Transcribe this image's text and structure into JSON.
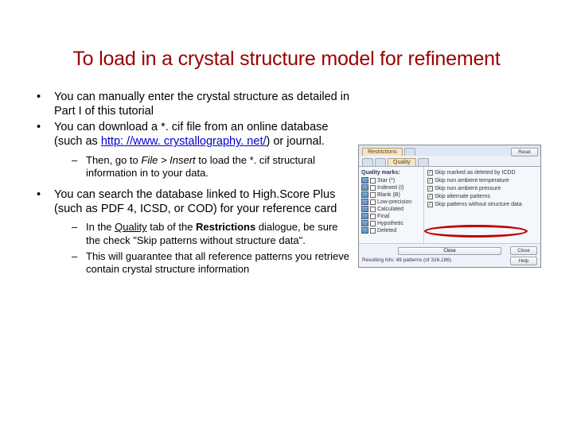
{
  "title": "To load in a crystal structure model for refinement",
  "bullets": {
    "b1": "You can manually enter the crystal structure as detailed in Part I of this tutorial",
    "b2a": "You can download a *. cif file from an online database (such as ",
    "b2_link": "http: //www. crystallography. net/",
    "b2b": ") or journal.",
    "b2_sub1a": "Then, go to ",
    "b2_sub1b": "File > Insert",
    "b2_sub1c": " to load the *. cif structural information in to your data.",
    "b3": "You can search the database linked to High.Score Plus (such as PDF 4, ICSD, or COD) for your reference card",
    "b3_sub1a": "In the ",
    "b3_sub1b": "Quality",
    "b3_sub1c": " tab of the ",
    "b3_sub1d": "Restrictions",
    "b3_sub1e": " dialogue, be sure the check \"Skip patterns without structure data\".",
    "b3_sub2": "This will guarantee that all reference patterns you retrieve contain crystal structure information"
  },
  "mock": {
    "tab1": "Restrictions",
    "tab2": "",
    "subtabs": {
      "t1": "",
      "t2": "",
      "t3": "Quality",
      "t4": ""
    },
    "left_title": "Quality marks:",
    "left_items": [
      "Star (*)",
      "Indexed (I)",
      "Blank (B)",
      "Low-precision",
      "Calculated",
      "Final",
      "Hypothetic",
      "Deleted"
    ],
    "right_items": [
      "Skip marked as deleted by ICDD",
      "Skip non ambient temperature",
      "Skip non ambient pressure",
      "Skip alternate patterns",
      "Skip patterns without structure data"
    ],
    "btn_reset": "Reset",
    "btn_close": "Close",
    "btn_help": "Help",
    "btn_long": "Close",
    "result": "Resulting hits: 49 patterns (of 316,186)"
  }
}
